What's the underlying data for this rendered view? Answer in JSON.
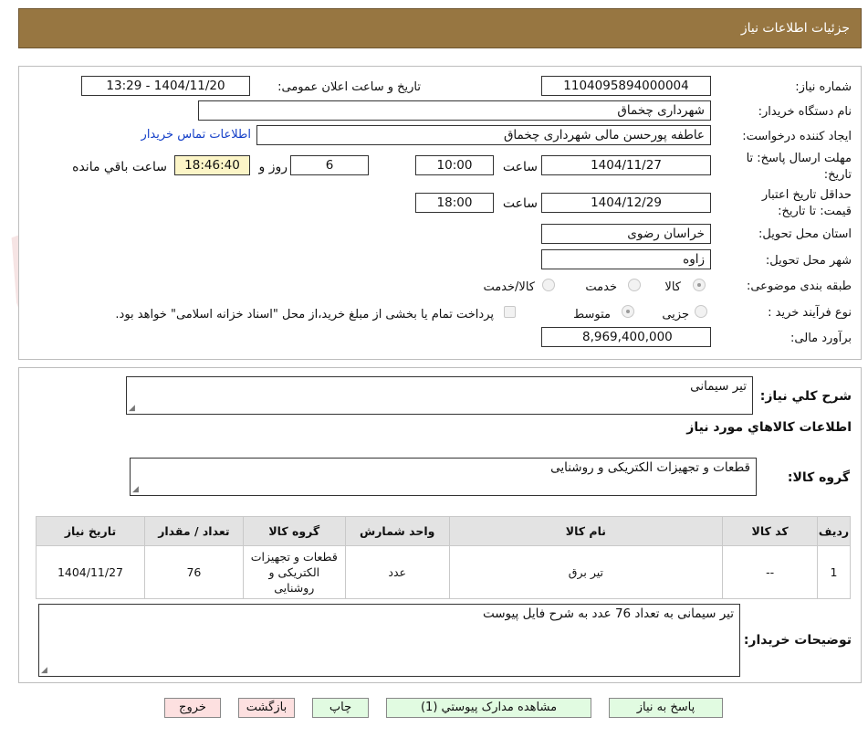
{
  "header": {
    "title": "جزئیات اطلاعات نیاز"
  },
  "watermark": {
    "text": "AriaTender.neT",
    "color": "#c23838"
  },
  "form": {
    "need_number_label": "شماره نیاز:",
    "need_number": "1104095894000004",
    "announce_label": "تاریخ و ساعت اعلان عمومی:",
    "announce_value": "1404/11/20 - 13:29",
    "buyer_org_label": "نام دستگاه خریدار:",
    "buyer_org": "شهرداری چخماق",
    "creator_label": "ایجاد کننده درخواست:",
    "creator": "عاطفه پورحسن مالی شهرداری چخماق",
    "contact_link": "اطلاعات تماس خریدار",
    "reply_deadline_label_1": "مهلت ارسال پاسخ: تا",
    "reply_deadline_label_2": "تاریخ:",
    "reply_date": "1404/11/27",
    "time_label": "ساعت",
    "reply_time": "10:00",
    "days_value": "6",
    "days_label": "روز و",
    "remaining_time": "18:46:40",
    "remaining_label": "ساعت باقي مانده",
    "validity_label_1": "حداقل تاریخ اعتبار",
    "validity_label_2": "قیمت: تا تاریخ:",
    "validity_date": "1404/12/29",
    "validity_time": "18:00",
    "province_label": "استان محل تحویل:",
    "province": "خراسان رضوی",
    "city_label": "شهر محل تحویل:",
    "city": "زاوه",
    "category_label": "طبقه بندی موضوعی:",
    "category_options": [
      "کالا",
      "خدمت",
      "کالا/خدمت"
    ],
    "process_label": "نوع فرآیند خرید :",
    "process_options": [
      "جزیی",
      "متوسط"
    ],
    "treasury_text": "پرداخت تمام یا بخشی از مبلغ خرید،از محل \"اسناد خزانه اسلامی\" خواهد بود.",
    "budget_label": "برآورد مالی:",
    "budget": "8,969,400,000"
  },
  "general": {
    "summary_label": "شرح کلي نیاز:",
    "summary": "تیر سیمانی",
    "items_title": "اطلاعات کالاهاي مورد نیاز",
    "group_label": "گروه کالا:",
    "group": "قطعات و تجهیزات الکتریکی و روشنایی"
  },
  "table": {
    "headers": [
      "ردیف",
      "کد کالا",
      "نام کالا",
      "واحد شمارش",
      "گروه کالا",
      "تعداد / مقدار",
      "تاریخ نیاز"
    ],
    "rows": [
      {
        "row": "1",
        "code": "--",
        "name": "تیر برق",
        "unit": "عدد",
        "group": "قطعات و تجهیزات الکتریکی و روشنایی",
        "qty": "76",
        "date": "1404/11/27"
      }
    ]
  },
  "buyer_notes": {
    "label": "توضیحات خریدار:",
    "text": "تیر سیمانی به تعداد 76 عدد به شرح فایل پیوست"
  },
  "buttons": {
    "reply": "پاسخ به نیاز",
    "attachments": "مشاهده مدارک پیوستي (1)",
    "print": "چاپ",
    "back": "بازگشت",
    "exit": "خروج"
  }
}
